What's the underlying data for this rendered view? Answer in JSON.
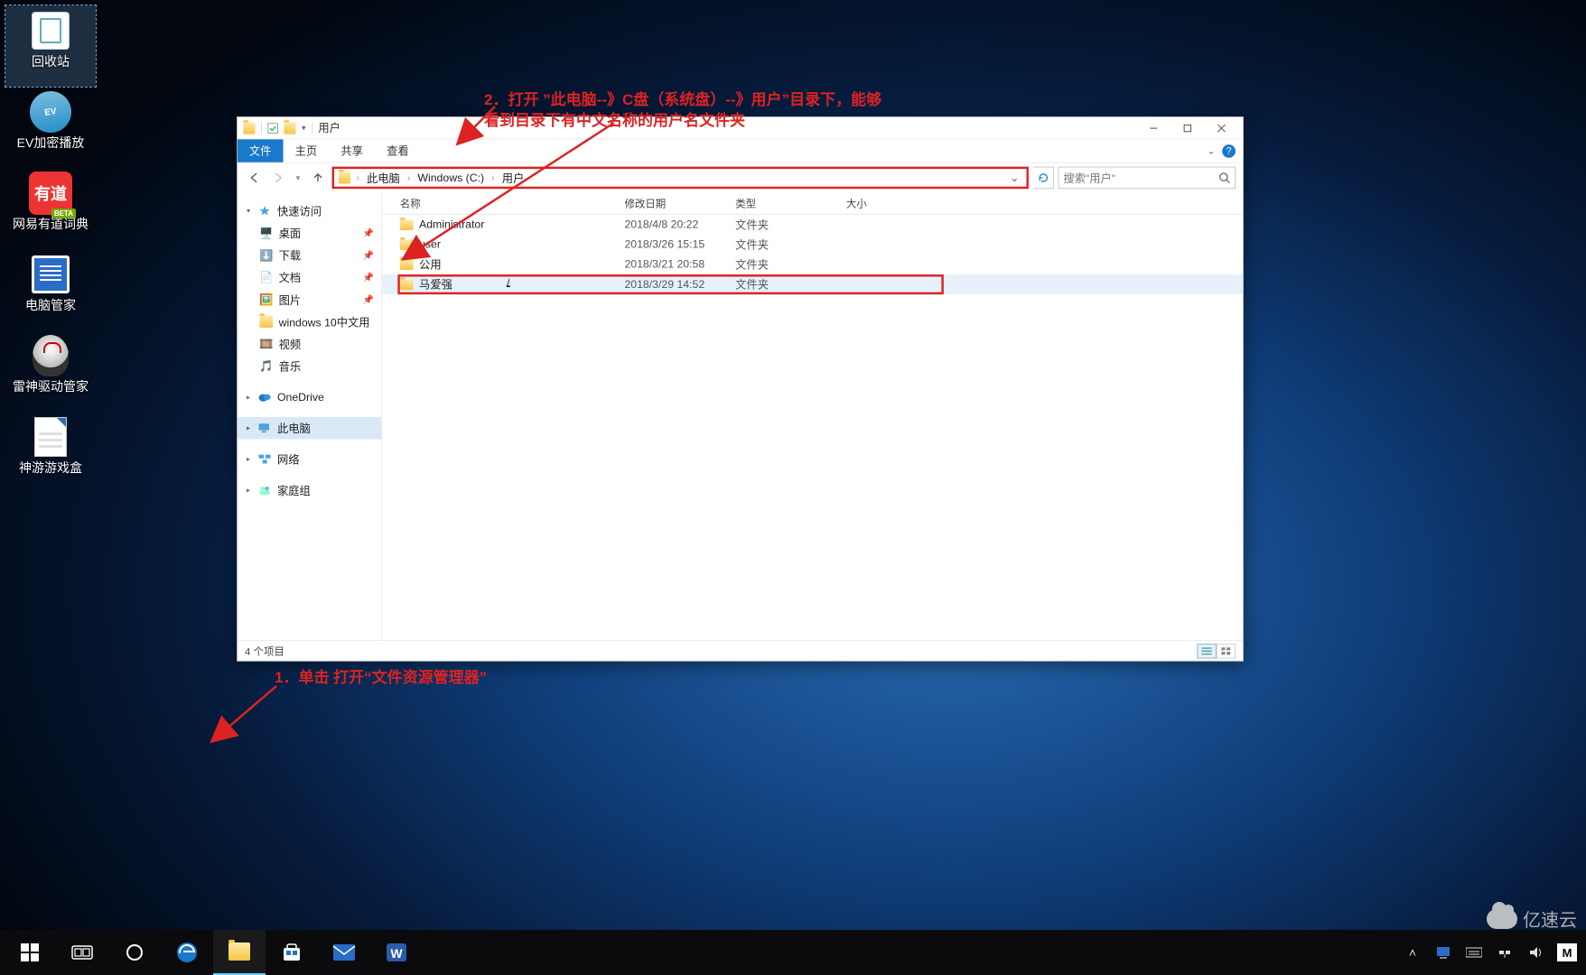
{
  "desktop_icons": [
    {
      "id": "recycle-bin",
      "label": "回收站"
    },
    {
      "id": "ev-player",
      "label": "EV加密播放"
    },
    {
      "id": "youdao",
      "label": "网易有道词典"
    },
    {
      "id": "pc-manager",
      "label": "电脑管家"
    },
    {
      "id": "thunder-drv",
      "label": "雷神驱动管家"
    },
    {
      "id": "shenyou",
      "label": "神游游戏盒"
    }
  ],
  "explorer": {
    "title": "用户",
    "ribbon": {
      "file": "文件",
      "home": "主页",
      "share": "共享",
      "view": "查看"
    },
    "breadcrumbs": [
      "此电脑",
      "Windows (C:)",
      "用户"
    ],
    "search_placeholder": "搜索\"用户\"",
    "sidebar": {
      "quick_access": "快速访问",
      "items": [
        "桌面",
        "下载",
        "文档",
        "图片",
        "windows 10中文用",
        "视频",
        "音乐"
      ],
      "onedrive": "OneDrive",
      "this_pc": "此电脑",
      "network": "网络",
      "homegroup": "家庭组"
    },
    "columns": {
      "name": "名称",
      "date": "修改日期",
      "type": "类型",
      "size": "大小"
    },
    "rows": [
      {
        "name": "Administrator",
        "date": "2018/4/8 20:22",
        "type": "文件夹"
      },
      {
        "name": "user",
        "date": "2018/3/26 15:15",
        "type": "文件夹"
      },
      {
        "name": "公用",
        "date": "2018/3/21 20:58",
        "type": "文件夹"
      },
      {
        "name": "马爱强",
        "date": "2018/3/29 14:52",
        "type": "文件夹"
      }
    ],
    "status": "4 个项目"
  },
  "annotations": {
    "a1": "1．单击 打开“文件资源管理器”",
    "a2": "2．打开 ”此电脑--》C盘（系统盘）--》用户”目录下，能够\n看到目录下有中文名称的用户名文件夹"
  },
  "watermark": "亿速云",
  "ime": "M",
  "colors": {
    "accent": "#1979ca",
    "annot": "#d22"
  }
}
